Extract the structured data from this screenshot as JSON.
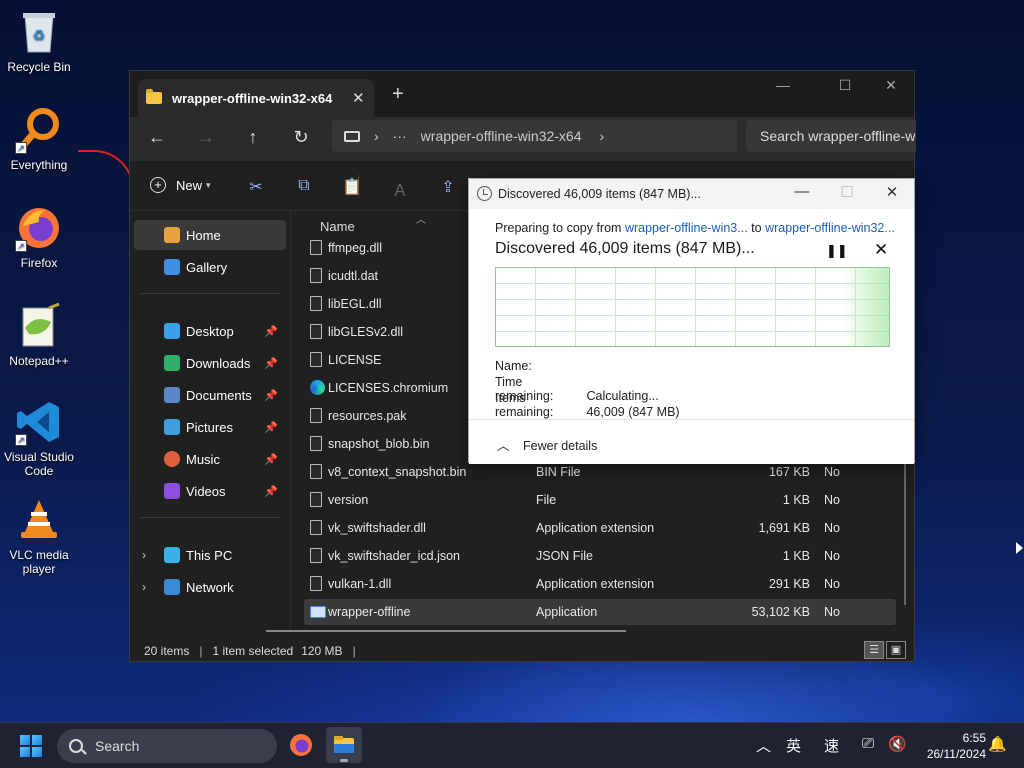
{
  "desktop": {
    "icons": [
      {
        "label": "Recycle Bin",
        "icon": "recycle-bin-icon"
      },
      {
        "label": "Everything",
        "icon": "everything-search-icon"
      },
      {
        "label": "Firefox",
        "icon": "firefox-icon"
      },
      {
        "label": "Notepad++",
        "icon": "notepadpp-icon"
      },
      {
        "label": "Visual Studio Code",
        "icon": "vscode-icon"
      },
      {
        "label": "VLC media player",
        "icon": "vlc-icon"
      }
    ]
  },
  "explorer": {
    "tab_title": "wrapper-offline-win32-x64",
    "tab_close": "✕",
    "new_tab": "+",
    "address": {
      "more": "···",
      "folder": "wrapper-offline-win32-x64"
    },
    "search_placeholder": "Search wrapper-offline-w",
    "new_label": "New",
    "sidebar": {
      "home": "Home",
      "gallery": "Gallery",
      "pinned": [
        "Desktop",
        "Downloads",
        "Documents",
        "Pictures",
        "Music",
        "Videos"
      ],
      "this_pc": "This PC",
      "network": "Network"
    },
    "column_name": "Name",
    "files": [
      {
        "name": "ffmpeg.dll",
        "type": "",
        "size": "",
        "avail": ""
      },
      {
        "name": "icudtl.dat",
        "type": "",
        "size": "",
        "avail": ""
      },
      {
        "name": "libEGL.dll",
        "type": "",
        "size": "",
        "avail": ""
      },
      {
        "name": "libGLESv2.dll",
        "type": "",
        "size": "",
        "avail": ""
      },
      {
        "name": "LICENSE",
        "type": "",
        "size": "",
        "avail": ""
      },
      {
        "name": "LICENSES.chromium",
        "type": "",
        "size": "",
        "avail": ""
      },
      {
        "name": "resources.pak",
        "type": "",
        "size": "",
        "avail": ""
      },
      {
        "name": "snapshot_blob.bin",
        "type": "",
        "size": "",
        "avail": ""
      },
      {
        "name": "v8_context_snapshot.bin",
        "type": "BIN File",
        "size": "167 KB",
        "avail": "No"
      },
      {
        "name": "version",
        "type": "File",
        "size": "1 KB",
        "avail": "No"
      },
      {
        "name": "vk_swiftshader.dll",
        "type": "Application extension",
        "size": "1,691 KB",
        "avail": "No"
      },
      {
        "name": "vk_swiftshader_icd.json",
        "type": "JSON File",
        "size": "1 KB",
        "avail": "No"
      },
      {
        "name": "vulkan-1.dll",
        "type": "Application extension",
        "size": "291 KB",
        "avail": "No"
      },
      {
        "name": "wrapper-offline",
        "type": "Application",
        "size": "53,102 KB",
        "avail": "No"
      }
    ],
    "status": {
      "count": "20 items",
      "selected": "1 item selected",
      "size": "120 MB"
    }
  },
  "copy_dialog": {
    "title": "Discovered 46,009 items (847 MB)...",
    "prep_prefix": "Preparing to copy from",
    "from": "wrapper-offline-win3...",
    "to_word": "to",
    "to": "wrapper-offline-win32...",
    "heading": "Discovered 46,009 items (847 MB)...",
    "name_label": "Name:",
    "name_value": "",
    "time_label": "Time remaining:",
    "time_value": "Calculating...",
    "items_label": "Items remaining:",
    "items_value": "46,009 (847 MB)",
    "fewer_details": "Fewer details"
  },
  "taskbar": {
    "search": "Search",
    "tray": {
      "ime1": "英",
      "ime2": "速"
    },
    "time": "6:55",
    "date": "26/11/2024"
  },
  "colors": {
    "accent": "#1a5fb4",
    "graph_green": "#8fc98f",
    "folder": "#f5c445"
  }
}
